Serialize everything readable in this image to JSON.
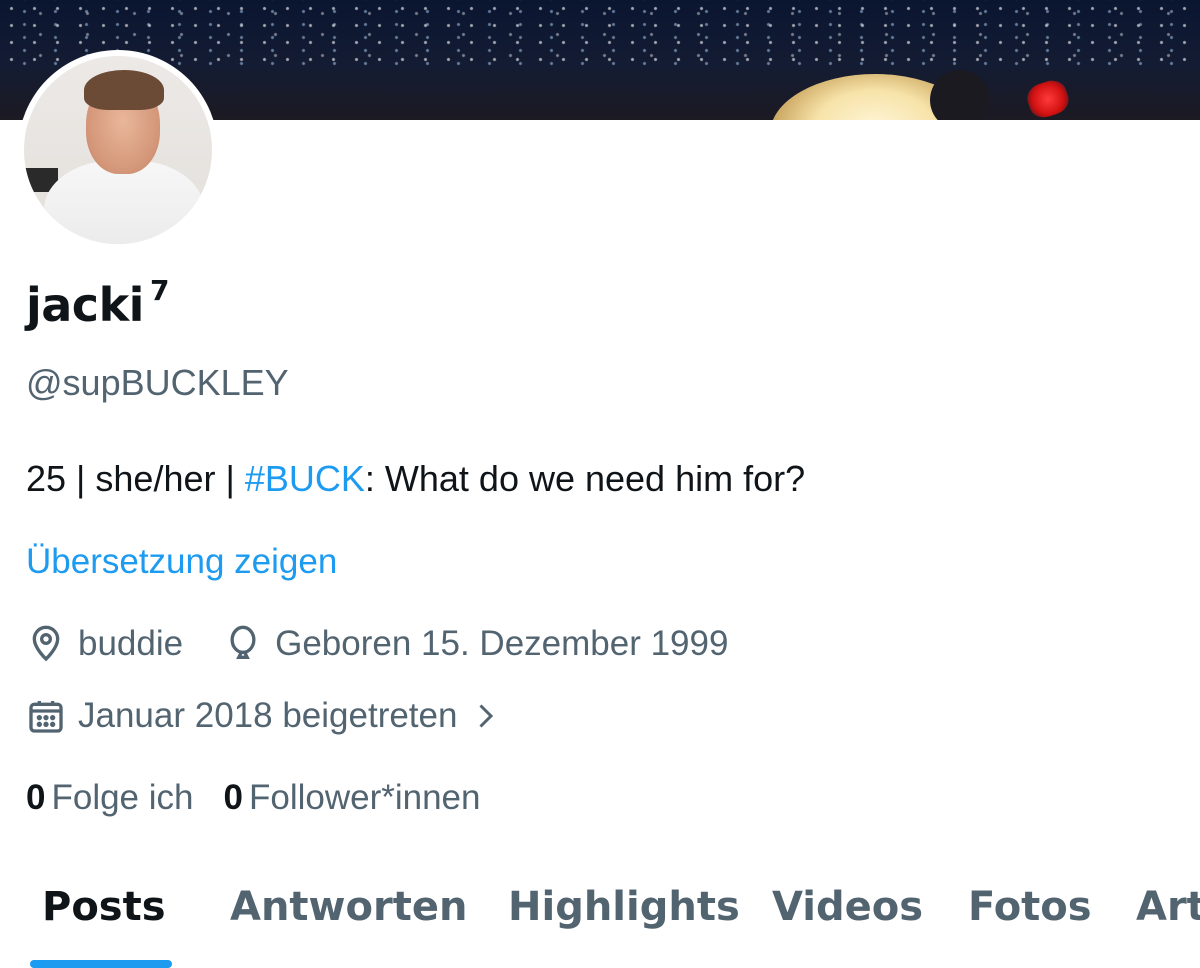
{
  "profile": {
    "name": "jacki",
    "name_suffix": "7",
    "handle": "@supBUCKLEY",
    "bio_prefix": "25 | she/her | ",
    "bio_hashtag": "#BUCK",
    "bio_suffix": ": What do we need him for?",
    "translate_link": "Übersetzung zeigen",
    "location": "buddie",
    "birthday": "Geboren 15. Dezember 1999",
    "joined": "Januar 2018 beigetreten",
    "following_count": "0",
    "following_label": "Folge ich",
    "followers_count": "0",
    "followers_label": "Follower*innen"
  },
  "tabs": [
    {
      "label": "Posts",
      "active": true
    },
    {
      "label": "Antworten"
    },
    {
      "label": "Highlights"
    },
    {
      "label": "Videos"
    },
    {
      "label": "Fotos"
    },
    {
      "label": "Artikel"
    }
  ],
  "colors": {
    "accent": "#1d9bf0",
    "text_primary": "#0f1419",
    "text_secondary": "#536471"
  },
  "icons": {
    "location": "location-pin-icon",
    "birthday": "balloon-icon",
    "joined": "calendar-icon",
    "chevron": "chevron-right-icon"
  }
}
